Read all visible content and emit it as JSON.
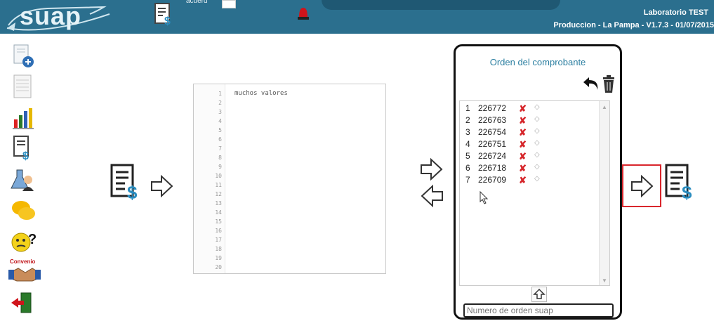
{
  "header": {
    "logo_text": "suap",
    "top_label": "acuerd",
    "lab_name": "Laboratorio TEST",
    "environment": "Produccion - La Pampa - V1.7.3 - 01/07/2015"
  },
  "sidebar": {
    "items": [
      {
        "icon": "new-document-icon"
      },
      {
        "icon": "report-sheet-icon"
      },
      {
        "icon": "bar-chart-icon"
      },
      {
        "icon": "billing-document-icon"
      },
      {
        "icon": "lab-technician-icon"
      },
      {
        "icon": "chat-bubbles-icon"
      },
      {
        "icon": "help-icon"
      },
      {
        "icon": "convenio-icon",
        "label": "Convenio"
      },
      {
        "icon": "exit-icon"
      }
    ]
  },
  "editor": {
    "line_numbers": [
      "1",
      "2",
      "3",
      "4",
      "5",
      "6",
      "7",
      "8",
      "9",
      "10",
      "11",
      "12",
      "13",
      "14",
      "15",
      "16",
      "17",
      "18",
      "19",
      "20"
    ],
    "content": "muchos valores"
  },
  "order_panel": {
    "title": "Orden del comprobante",
    "rows": [
      {
        "index": "1",
        "number": "226772"
      },
      {
        "index": "2",
        "number": "226763"
      },
      {
        "index": "3",
        "number": "226754"
      },
      {
        "index": "4",
        "number": "226751"
      },
      {
        "index": "5",
        "number": "226724"
      },
      {
        "index": "6",
        "number": "226718"
      },
      {
        "index": "7",
        "number": "226709"
      }
    ],
    "input_placeholder": "Numero de orden suap"
  },
  "colors": {
    "header_bg": "#2b6f8e",
    "accent_blue": "#2a7ea0",
    "delete_red": "#d6262b",
    "highlight_red": "#d9262c"
  }
}
